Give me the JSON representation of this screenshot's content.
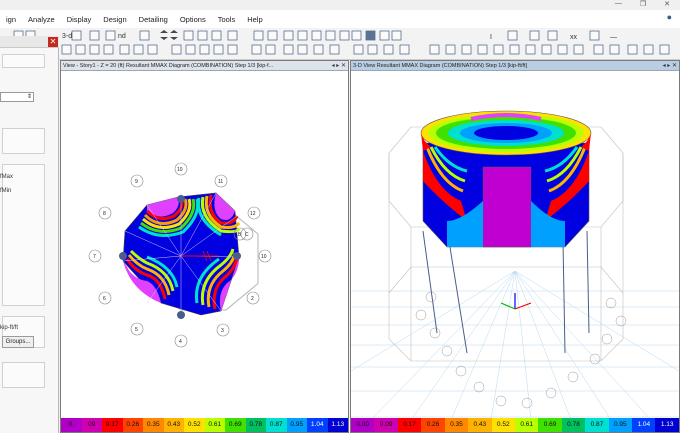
{
  "menu": [
    "ign",
    "Analyze",
    "Display",
    "Design",
    "Detailing",
    "Options",
    "Tools",
    "Help"
  ],
  "window_controls": [
    "—",
    "❐",
    "✕"
  ],
  "left_panel": {
    "texts": [
      "fMax",
      "fMin",
      "kip-ft/ft"
    ],
    "groups_button": "Groups..."
  },
  "views": {
    "left": {
      "title": "View - Story1 - Z = 20 (ft)   Resultant MMAX Diagram   (COMBINATION)  Step 1/3  [kip-f...",
      "nav": "◂ ▸ ✕"
    },
    "right": {
      "title": "3-D View   Resultant MMAX Diagram   (COMBINATION)  Step 1/3  [kip-ft/ft]",
      "nav": "◂ ▸ ✕"
    }
  },
  "plan_labels": [
    "10",
    "11",
    "12",
    "C",
    "B",
    "10",
    "2",
    "3",
    "4",
    "5",
    "6",
    "7",
    "8",
    "9"
  ],
  "legend": {
    "left": [
      "0.",
      "09",
      "0.17",
      "0.26",
      "0.35",
      "0.43",
      "0.52",
      "0.61",
      "0.69",
      "0.78",
      "0.87",
      "0.95",
      "1.04",
      "1.13"
    ],
    "right": [
      "0.00",
      "0.09",
      "0.17",
      "0.26",
      "0.35",
      "0.43",
      "0.52",
      "0.61",
      "0.69",
      "0.78",
      "0.87",
      "0.95",
      "1.04",
      "1.13"
    ]
  },
  "colors": {
    "legend": [
      "#b000c8",
      "#d000b0",
      "#ff0000",
      "#ff4400",
      "#ff8800",
      "#ffb300",
      "#ffe000",
      "#b8ff00",
      "#40e000",
      "#00c060",
      "#00e0d0",
      "#00a0ff",
      "#0040ff",
      "#0000d0"
    ]
  }
}
